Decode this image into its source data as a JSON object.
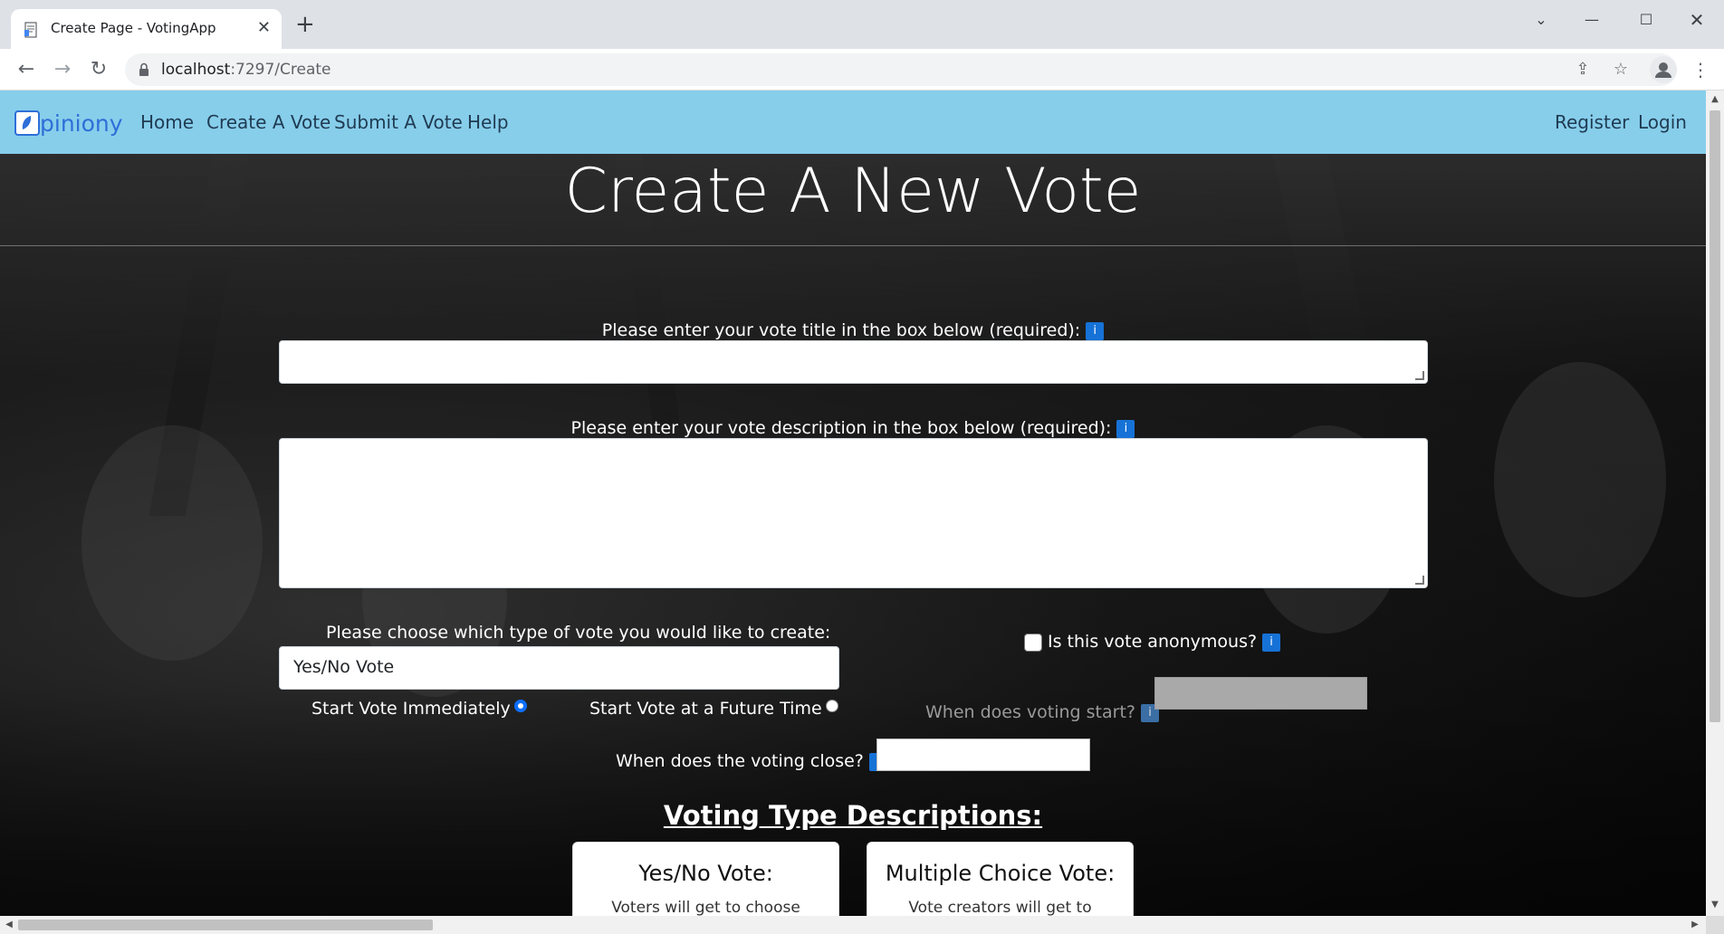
{
  "browser": {
    "tab_title": "Create Page - VotingApp",
    "url_host": "localhost",
    "url_path": ":7297/Create"
  },
  "nav": {
    "brand": "piniony",
    "links": [
      "Home",
      "Create A Vote",
      "Submit A Vote",
      "Help"
    ],
    "right_links": [
      "Register",
      "Login"
    ]
  },
  "page": {
    "title": "Create A New Vote",
    "vote_title_label": "Please enter your vote title in the box below (required):",
    "vote_title_value": "",
    "description_label": "Please enter your vote description in the box below (required):",
    "description_value": "",
    "type_label": "Please choose which type of vote you would like to create:",
    "type_selected": "Yes/No Vote",
    "anonymous_label": "Is this vote anonymous?",
    "anonymous_checked": false,
    "start_immediately_label": "Start Vote Immediately",
    "start_immediately_selected": true,
    "start_future_label": "Start Vote at a Future Time",
    "start_future_selected": false,
    "voting_start_label": "When does voting start?",
    "voting_close_label": "When does the voting close?",
    "info_badge": "i",
    "descriptions_heading": "Voting Type Descriptions:",
    "cards": [
      {
        "title": "Yes/No Vote:",
        "text": "Voters will get to choose"
      },
      {
        "title": "Multiple Choice Vote:",
        "text": "Vote creators will get to"
      }
    ]
  },
  "colors": {
    "navbar_bg": "#87ceeb",
    "brand": "#2e6fd8",
    "info_badge": "#1672d6",
    "radio_checked": "#0d6efd"
  },
  "icons": [
    "page-icon",
    "close-icon",
    "plus-icon",
    "chevron-down-icon",
    "minimize-icon",
    "maximize-icon",
    "back-icon",
    "forward-icon",
    "reload-icon",
    "lock-icon",
    "share-icon",
    "star-icon",
    "profile-icon",
    "menu-icon",
    "leaf-icon"
  ]
}
